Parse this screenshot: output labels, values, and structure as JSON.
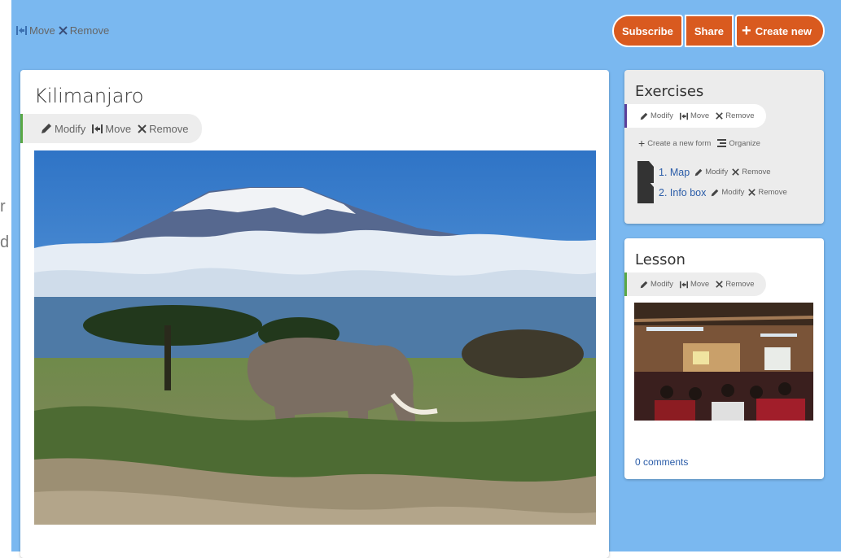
{
  "topbar": {
    "tools": {
      "move": "Move",
      "remove": "Remove"
    },
    "buttons": {
      "subscribe": "Subscribe",
      "share": "Share",
      "create_new": "Create new"
    }
  },
  "left_fragments": [
    "r",
    "d"
  ],
  "main": {
    "title": "Kilimanjaro",
    "toolbar": {
      "modify": "Modify",
      "move": "Move",
      "remove": "Remove"
    }
  },
  "exercises": {
    "title": "Exercises",
    "toolbar": {
      "modify": "Modify",
      "move": "Move",
      "remove": "Remove"
    },
    "actions": {
      "create": "Create a new form",
      "organize": "Organize"
    },
    "items": [
      {
        "label": "1. Map",
        "modify": "Modify",
        "remove": "Remove"
      },
      {
        "label": "2. Info box",
        "modify": "Modify",
        "remove": "Remove"
      }
    ]
  },
  "lesson": {
    "title": "Lesson",
    "toolbar": {
      "modify": "Modify",
      "move": "Move",
      "remove": "Remove"
    },
    "comments": "0 comments"
  },
  "colors": {
    "background": "#7ab8f0",
    "button": "#d95a1f",
    "link": "#2a5ca8",
    "accent_green": "#5aa845",
    "accent_purple": "#5b3f98"
  }
}
